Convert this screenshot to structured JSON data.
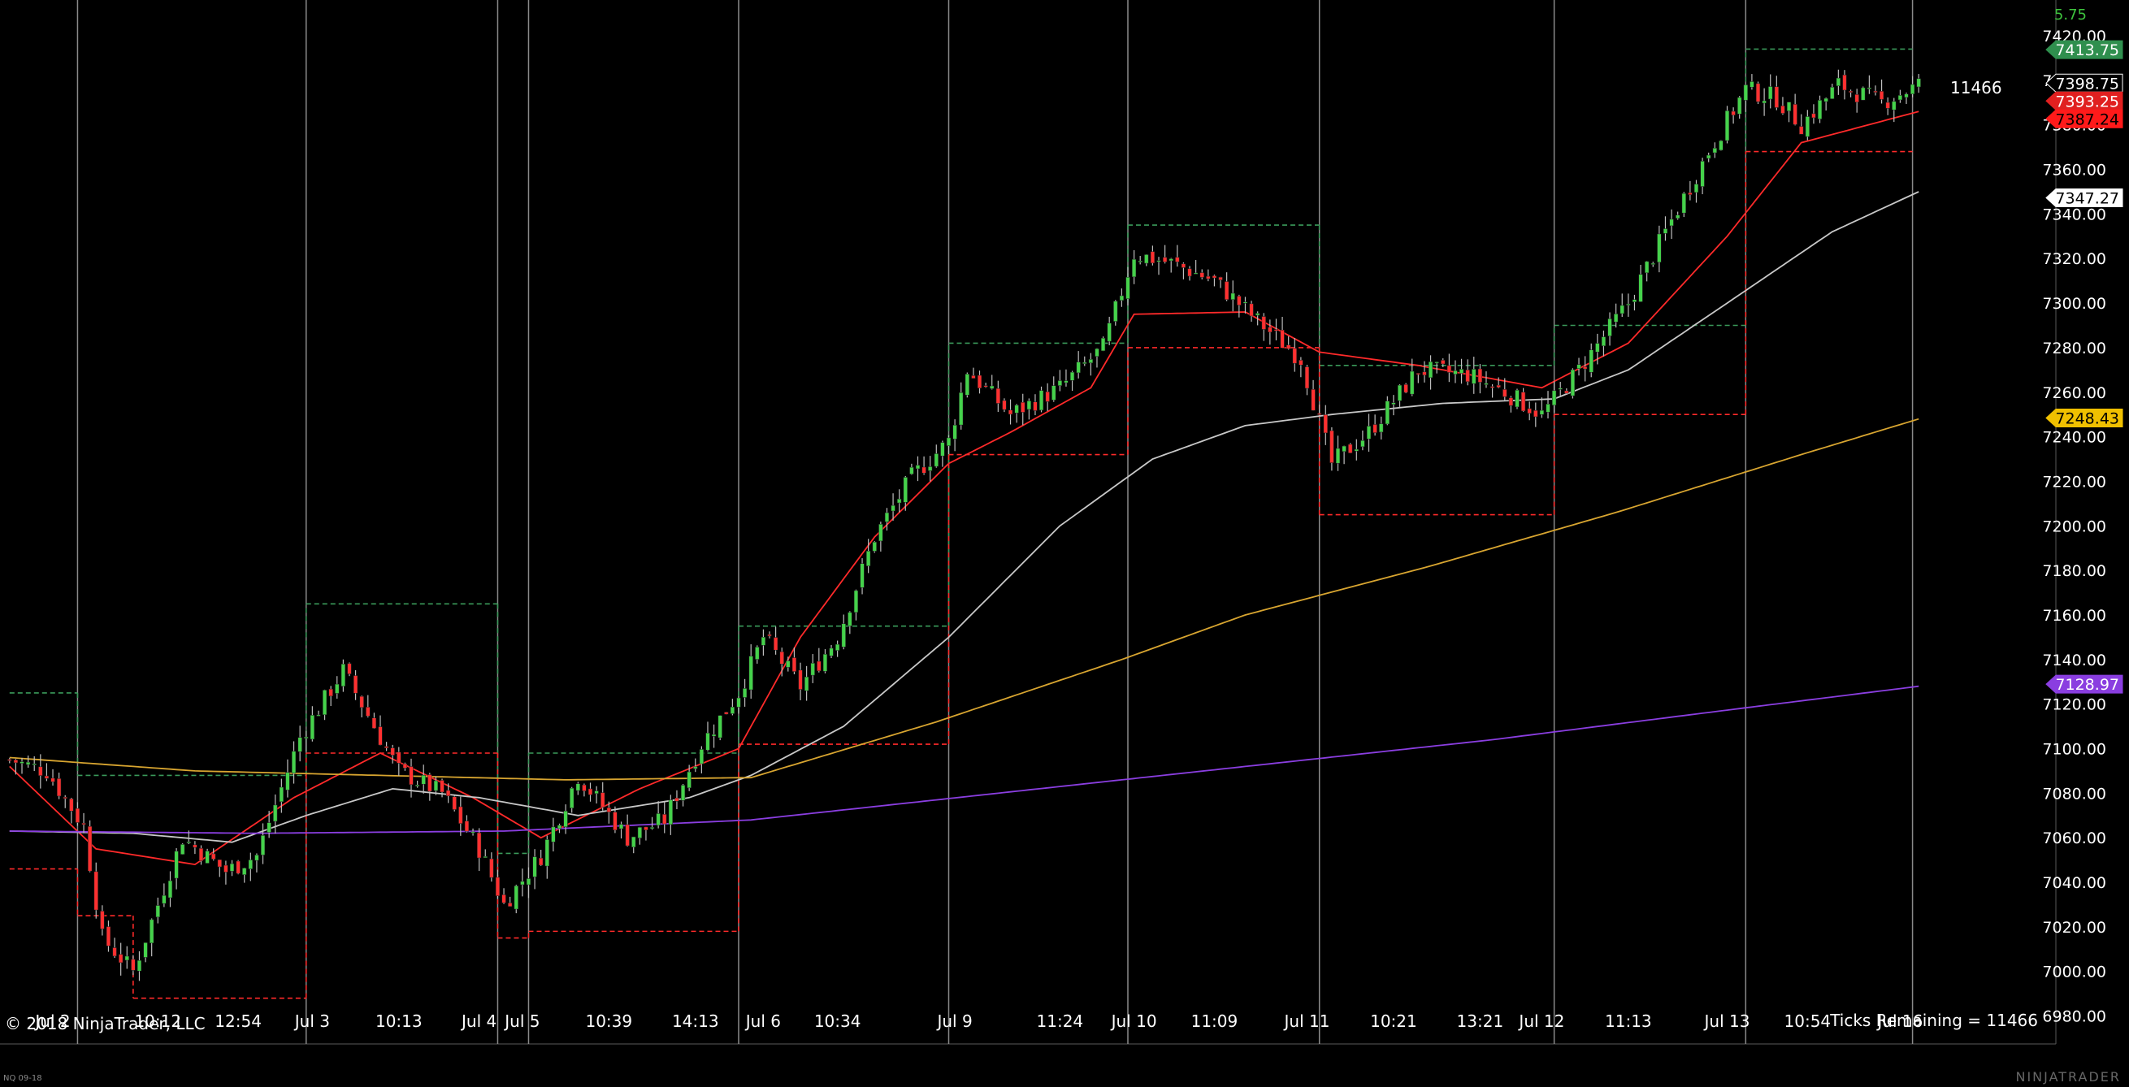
{
  "chart_data": {
    "type": "candlestick",
    "instrument_code": "NQ 09-18",
    "y_range": [
      6970,
      7420
    ],
    "y_ticks": [
      6980,
      7000,
      7020,
      7040,
      7060,
      7080,
      7100,
      7120,
      7140,
      7160,
      7180,
      7200,
      7220,
      7240,
      7260,
      7280,
      7300,
      7320,
      7340,
      7360,
      7380,
      7400,
      7420
    ],
    "y_tick_labels": [
      "6980.00",
      "7000.00",
      "7020.00",
      "7040.00",
      "7060.00",
      "7080.00",
      "7100.00",
      "7120.00",
      "7140.00",
      "7160.00",
      "7180.00",
      "7200.00",
      "7220.00",
      "7240.00",
      "7260.00",
      "7280.00",
      "7300.00",
      "7320.00",
      "7340.00",
      "7360.00",
      "7380.00",
      "7400.00",
      "7420.00"
    ],
    "x_labels": [
      "Jul 2",
      "10:12",
      "12:54",
      "Jul 3",
      "10:13",
      "Jul 4",
      "Jul 5",
      "10:39",
      "14:13",
      "Jul 6",
      "10:34",
      "Jul 9",
      "11:24",
      "Jul 10",
      "11:09",
      "Jul 11",
      "10:21",
      "13:21",
      "Jul 12",
      "11:13",
      "Jul 13",
      "10:54",
      "Jul 16"
    ],
    "x_label_positions": [
      7,
      24,
      37,
      49,
      63,
      76,
      83,
      97,
      111,
      122,
      134,
      153,
      170,
      182,
      195,
      210,
      224,
      238,
      248,
      262,
      278,
      291,
      306
    ],
    "session_separators": [
      11,
      48,
      79,
      84,
      118,
      152,
      181,
      212,
      250,
      281,
      308
    ],
    "n_bars": 310,
    "candles_anchor_closes": [
      [
        0,
        7095
      ],
      [
        6,
        7090
      ],
      [
        12,
        7065
      ],
      [
        15,
        7015
      ],
      [
        20,
        7000
      ],
      [
        28,
        7060
      ],
      [
        35,
        7045
      ],
      [
        40,
        7052
      ],
      [
        47,
        7105
      ],
      [
        54,
        7135
      ],
      [
        58,
        7115
      ],
      [
        63,
        7090
      ],
      [
        70,
        7080
      ],
      [
        76,
        7055
      ],
      [
        80,
        7030
      ],
      [
        86,
        7052
      ],
      [
        92,
        7088
      ],
      [
        100,
        7060
      ],
      [
        106,
        7068
      ],
      [
        112,
        7102
      ],
      [
        118,
        7125
      ],
      [
        122,
        7150
      ],
      [
        128,
        7128
      ],
      [
        134,
        7150
      ],
      [
        140,
        7195
      ],
      [
        146,
        7222
      ],
      [
        152,
        7238
      ],
      [
        155,
        7270
      ],
      [
        162,
        7250
      ],
      [
        170,
        7262
      ],
      [
        177,
        7280
      ],
      [
        182,
        7322
      ],
      [
        188,
        7318
      ],
      [
        195,
        7310
      ],
      [
        202,
        7292
      ],
      [
        209,
        7275
      ],
      [
        214,
        7228
      ],
      [
        220,
        7242
      ],
      [
        228,
        7270
      ],
      [
        236,
        7268
      ],
      [
        242,
        7260
      ],
      [
        248,
        7250
      ],
      [
        254,
        7270
      ],
      [
        262,
        7300
      ],
      [
        268,
        7332
      ],
      [
        275,
        7368
      ],
      [
        281,
        7396
      ],
      [
        286,
        7392
      ],
      [
        290,
        7380
      ],
      [
        296,
        7398
      ],
      [
        303,
        7390
      ],
      [
        309,
        7398
      ]
    ],
    "series": [
      {
        "name": "",
        "color": "#ff2a2a",
        "anchors": [
          [
            0,
            7092
          ],
          [
            14,
            7055
          ],
          [
            30,
            7048
          ],
          [
            46,
            7078
          ],
          [
            60,
            7098
          ],
          [
            75,
            7078
          ],
          [
            86,
            7060
          ],
          [
            102,
            7082
          ],
          [
            118,
            7100
          ],
          [
            128,
            7150
          ],
          [
            140,
            7195
          ],
          [
            152,
            7228
          ],
          [
            162,
            7242
          ],
          [
            175,
            7262
          ],
          [
            182,
            7295
          ],
          [
            200,
            7296
          ],
          [
            212,
            7278
          ],
          [
            228,
            7272
          ],
          [
            248,
            7262
          ],
          [
            262,
            7282
          ],
          [
            278,
            7330
          ],
          [
            290,
            7372
          ],
          [
            309,
            7386
          ]
        ]
      },
      {
        "name": "",
        "color": "#c8c8c8",
        "anchors": [
          [
            0,
            7063
          ],
          [
            20,
            7062
          ],
          [
            36,
            7058
          ],
          [
            48,
            7070
          ],
          [
            62,
            7082
          ],
          [
            76,
            7078
          ],
          [
            92,
            7070
          ],
          [
            110,
            7078
          ],
          [
            120,
            7088
          ],
          [
            135,
            7110
          ],
          [
            152,
            7150
          ],
          [
            170,
            7200
          ],
          [
            185,
            7230
          ],
          [
            200,
            7245
          ],
          [
            214,
            7250
          ],
          [
            232,
            7255
          ],
          [
            250,
            7257
          ],
          [
            262,
            7270
          ],
          [
            278,
            7300
          ],
          [
            295,
            7332
          ],
          [
            309,
            7350
          ]
        ]
      },
      {
        "name": "",
        "color": "#d8a530",
        "anchors": [
          [
            0,
            7096
          ],
          [
            30,
            7090
          ],
          [
            60,
            7088
          ],
          [
            90,
            7086
          ],
          [
            120,
            7087
          ],
          [
            150,
            7112
          ],
          [
            180,
            7140
          ],
          [
            200,
            7160
          ],
          [
            230,
            7182
          ],
          [
            260,
            7206
          ],
          [
            290,
            7232
          ],
          [
            309,
            7248
          ]
        ]
      },
      {
        "name": "",
        "color": "#8a3ee0",
        "anchors": [
          [
            0,
            7063
          ],
          [
            40,
            7062
          ],
          [
            80,
            7063
          ],
          [
            120,
            7068
          ],
          [
            160,
            7080
          ],
          [
            200,
            7092
          ],
          [
            240,
            7104
          ],
          [
            280,
            7118
          ],
          [
            309,
            7128
          ]
        ]
      }
    ],
    "session_high_steps": [
      [
        0,
        11,
        7125
      ],
      [
        11,
        48,
        7088
      ],
      [
        48,
        79,
        7165
      ],
      [
        79,
        84,
        7053
      ],
      [
        84,
        118,
        7098
      ],
      [
        118,
        152,
        7155
      ],
      [
        152,
        181,
        7282
      ],
      [
        181,
        212,
        7335
      ],
      [
        212,
        250,
        7272
      ],
      [
        250,
        281,
        7290
      ],
      [
        281,
        308,
        7414
      ]
    ],
    "session_low_steps": [
      [
        0,
        11,
        7046
      ],
      [
        11,
        20,
        7025
      ],
      [
        20,
        48,
        6988
      ],
      [
        48,
        79,
        7098
      ],
      [
        79,
        84,
        7015
      ],
      [
        84,
        118,
        7018
      ],
      [
        118,
        152,
        7102
      ],
      [
        152,
        181,
        7232
      ],
      [
        181,
        212,
        7280
      ],
      [
        212,
        250,
        7205
      ],
      [
        250,
        281,
        7250
      ],
      [
        281,
        308,
        7368
      ]
    ],
    "price_markers": [
      {
        "label": "7413.75",
        "bg": "#2f8f4e",
        "fg": "#ffffff",
        "value": 7413.75
      },
      {
        "label": "7398.75",
        "bg": "#000000",
        "fg": "#ffffff",
        "border": "#ffffff",
        "value": 7398.75
      },
      {
        "label": "7393.25",
        "bg": "#e02020",
        "fg": "#ffffff",
        "value": 7393.25
      },
      {
        "label": "7387.24",
        "bg": "#ff1a1a",
        "fg": "#000000",
        "value": 7387.24
      },
      {
        "label": "7347.27",
        "bg": "#ffffff",
        "fg": "#000000",
        "value": 7347.27
      },
      {
        "label": "7248.43",
        "bg": "#f0c000",
        "fg": "#000000",
        "value": 7248.43
      },
      {
        "label": "7128.97",
        "bg": "#8a3ee0",
        "fg": "#ffffff",
        "value": 7128.97
      }
    ],
    "colors": {
      "up": "#45d24b",
      "down": "#ff3030",
      "wick": "#bfbfbf",
      "background": "#000000",
      "separator": "#8a8a8a",
      "high_step": "#3a9a5a",
      "low_step": "#ff2a2a",
      "axis_text": "#ffffff"
    }
  },
  "texts": {
    "copyright": "© 2018 NinjaTrader, LLC",
    "ticks_remaining": "Ticks Remaining = 11466",
    "corner_value": "5.75",
    "bar_counter": "11466",
    "footer_left": "NQ 09-18",
    "footer_right": "NINJATRADER"
  }
}
